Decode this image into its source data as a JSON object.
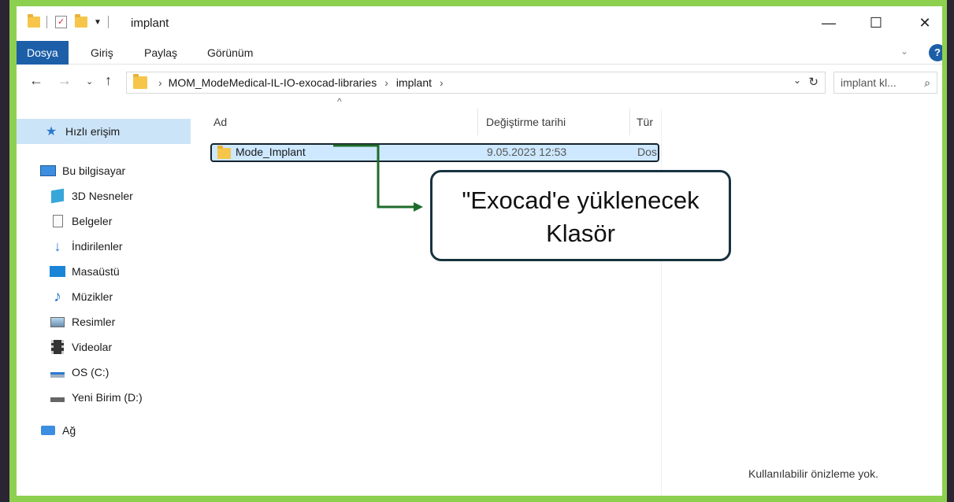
{
  "window": {
    "title": "implant",
    "controls": {
      "minimize": "—",
      "maximize": "☐",
      "close": "✕"
    }
  },
  "ribbon": {
    "tabs": [
      "Dosya",
      "Giriş",
      "Paylaş",
      "Görünüm"
    ],
    "active_tab": "Dosya"
  },
  "address": {
    "path": [
      "MOM_ModeMedical-IL-IO-exocad-libraries",
      "implant"
    ],
    "separator": "›",
    "search_placeholder": "implant kl..."
  },
  "sidebar": {
    "quick_access": "Hızlı erişim",
    "this_pc": "Bu bilgisayar",
    "items": [
      {
        "label": "3D Nesneler",
        "icon": "3d-objects-icon"
      },
      {
        "label": "Belgeler",
        "icon": "documents-icon"
      },
      {
        "label": "İndirilenler",
        "icon": "downloads-icon"
      },
      {
        "label": "Masaüstü",
        "icon": "desktop-icon"
      },
      {
        "label": "Müzikler",
        "icon": "music-icon"
      },
      {
        "label": "Resimler",
        "icon": "pictures-icon"
      },
      {
        "label": "Videolar",
        "icon": "videos-icon"
      },
      {
        "label": "OS (C:)",
        "icon": "drive-c-icon"
      },
      {
        "label": "Yeni Birim (D:)",
        "icon": "drive-d-icon"
      }
    ],
    "network": "Ağ"
  },
  "file_list": {
    "columns": [
      "Ad",
      "Değiştirme tarihi",
      "Tür"
    ],
    "rows": [
      {
        "name": "Mode_Implant",
        "modified": "9.05.2023 12:53",
        "type": "Dos"
      }
    ]
  },
  "preview_text": "Kullanılabilir önizleme yok.",
  "callout": {
    "line1": "\"Exocad'e yüklenecek",
    "line2": "Klasör"
  },
  "colors": {
    "frame": "#8dd050",
    "selection": "#cde8ff",
    "arrow": "#1f6b2a",
    "accent_tab": "#1c5fa8"
  }
}
